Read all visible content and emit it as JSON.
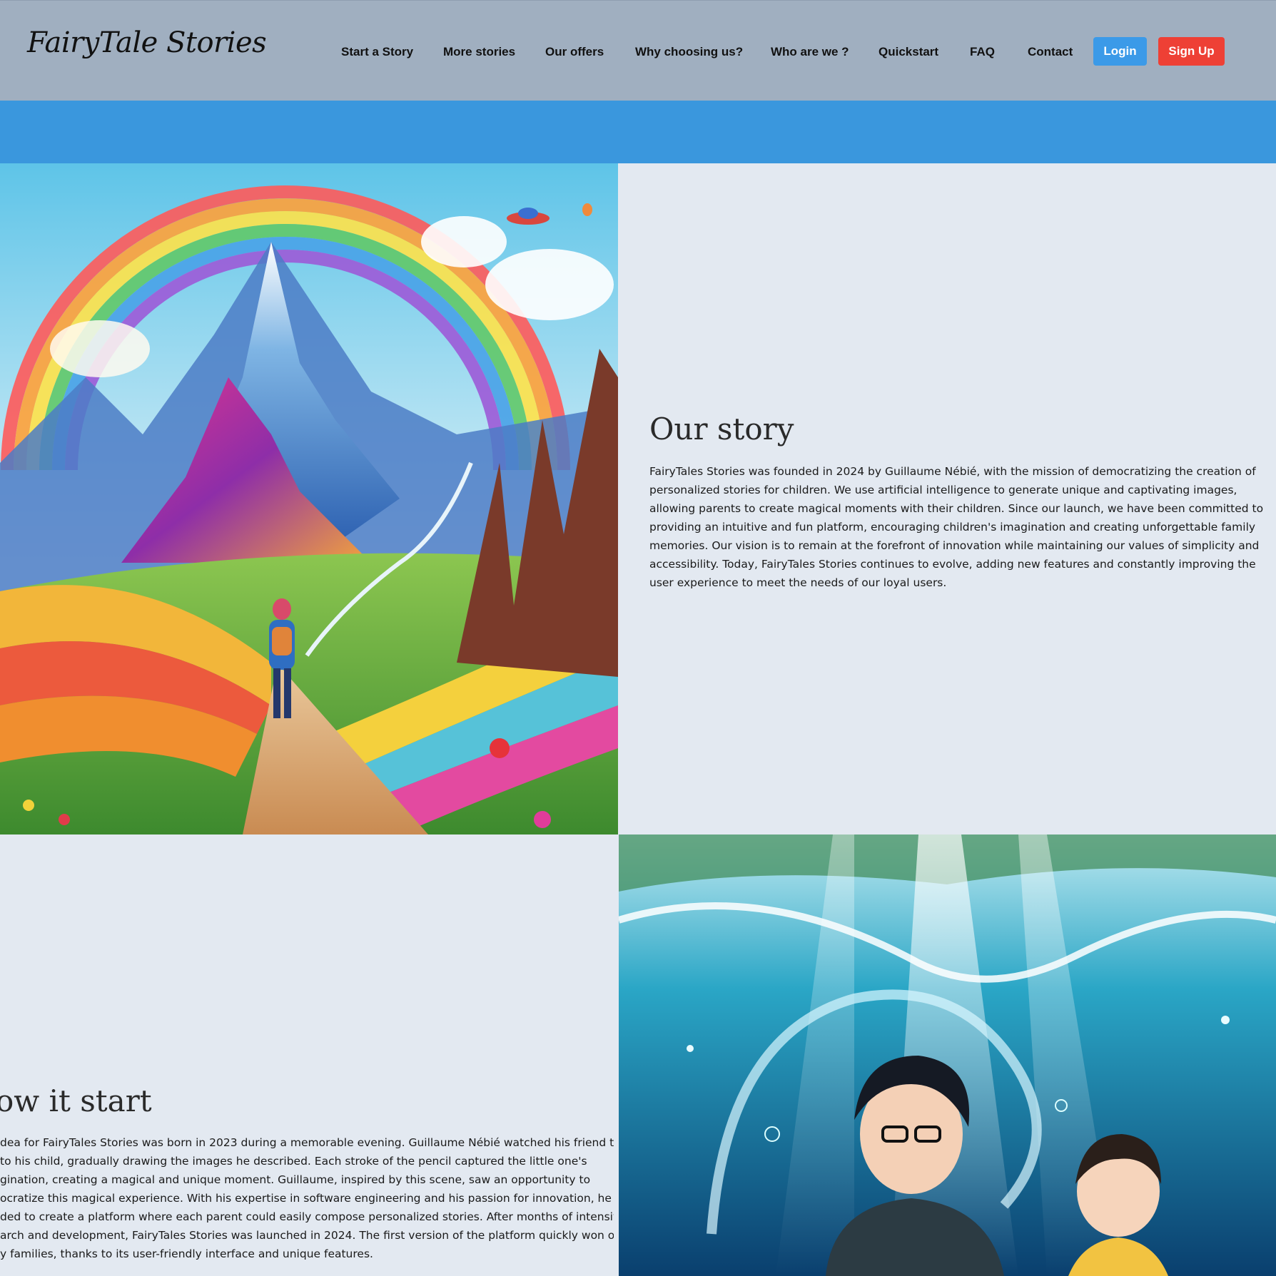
{
  "header": {
    "logo_text": "FairyTale Stories",
    "nav": [
      {
        "label": "Start a Story"
      },
      {
        "label": "More stories"
      },
      {
        "label": "Our offers"
      },
      {
        "label": "Why choosing us?"
      },
      {
        "label": "Who are we ?"
      },
      {
        "label": "Quickstart"
      },
      {
        "label": "FAQ"
      },
      {
        "label": "Contact"
      }
    ],
    "login_label": "Login",
    "signup_label": "Sign Up"
  },
  "colors": {
    "header_bg": "#a0afc0",
    "band_blue": "#3a97dd",
    "page_bg": "#e3e9f1",
    "login_bg": "#3b9ae8",
    "signup_bg": "#ee4035"
  },
  "our_story": {
    "title": "Our story",
    "text": "FairyTales Stories was founded in 2024 by Guillaume Nébié, with the mission of democratizing the creation of personalized stories for children. We use artificial intelligence to generate unique and captivating images, allowing parents to create magical moments with their children. Since our launch, we have been committed to providing an intuitive and fun platform, encouraging children's imagination and creating unforgettable family memories. Our vision is to remain at the forefront of innovation while maintaining our values of simplicity and accessibility. Today, FairyTales Stories continues to evolve, adding new features and constantly improving the user experience to meet the needs of our loyal users."
  },
  "how_it_start": {
    "title": "ow it start",
    "lines": [
      "dea for FairyTales Stories was born in 2023 during a memorable evening. Guillaume Nébié watched his friend tell a",
      "to his child, gradually drawing the images he described. Each stroke of the pencil captured the little one's",
      "gination, creating a magical and unique moment. Guillaume, inspired by this scene, saw an opportunity to",
      "ocratize this magical experience. With his expertise in software engineering and his passion for innovation, he",
      "ded to create a platform where each parent could easily compose personalized stories. After months of intensive",
      "arch and development, FairyTales Stories was launched in 2024. The first version of the platform quickly won over",
      "y families, thanks to its user-friendly interface and unique features."
    ]
  }
}
